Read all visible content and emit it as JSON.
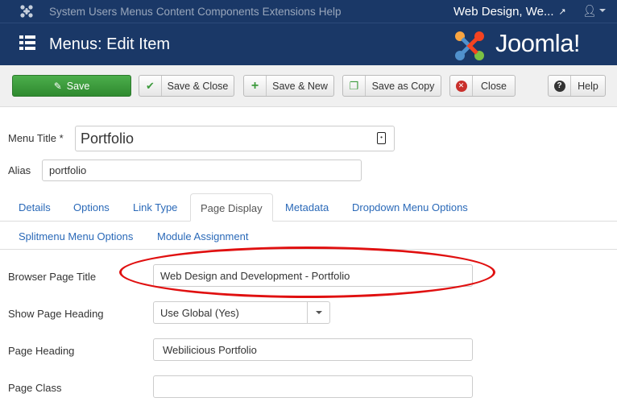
{
  "navbar": {
    "menu_items": [
      "System",
      "Users",
      "Menus",
      "Content",
      "Components",
      "Extensions",
      "Help"
    ],
    "site_name": "Web Design, We...",
    "site_ext_icon": "external-link-icon",
    "user_icon": "user-icon"
  },
  "header": {
    "title": "Menus: Edit Item",
    "brand": "Joomla!"
  },
  "toolbar": {
    "save": "Save",
    "save_close": "Save & Close",
    "save_new": "Save & New",
    "save_copy": "Save as Copy",
    "close": "Close",
    "help": "Help"
  },
  "form": {
    "menu_title_label": "Menu Title *",
    "menu_title_value": "Portfolio",
    "alias_label": "Alias",
    "alias_value": "portfolio"
  },
  "tabs": {
    "row1": [
      "Details",
      "Options",
      "Link Type",
      "Page Display",
      "Metadata",
      "Dropdown Menu Options"
    ],
    "row2": [
      "Splitmenu Menu Options",
      "Module Assignment"
    ],
    "active": "Page Display"
  },
  "page_display": {
    "browser_title_label": "Browser Page Title",
    "browser_title_value": "Web Design and Development - Portfolio",
    "show_heading_label": "Show Page Heading",
    "show_heading_value": "Use Global (Yes)",
    "page_heading_label": "Page Heading",
    "page_heading_value": "Webilicious Portfolio",
    "page_class_label": "Page Class",
    "page_class_value": ""
  },
  "colors": {
    "navbar_bg": "#1a3867",
    "save_green": "#3c9a3c",
    "link_blue": "#2a69b8",
    "highlight_red": "#e01010"
  }
}
